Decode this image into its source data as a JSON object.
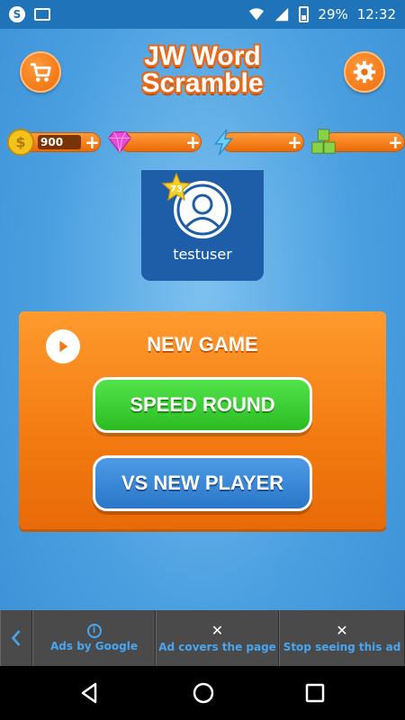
{
  "status_bar": {
    "battery": "29%",
    "time": "12:32",
    "icons": [
      "skype-icon",
      "image-icon",
      "wifi-icon",
      "signal-icon",
      "battery-icon"
    ]
  },
  "header": {
    "title_line1": "JW Word",
    "title_line2": "Scramble",
    "cart_icon": "shopping-cart-icon",
    "settings_icon": "gear-icon"
  },
  "currency": {
    "coins": "900",
    "plus": "+",
    "icons": [
      "coin-icon",
      "gem-icon",
      "lightning-icon",
      "letter-blocks-icon"
    ]
  },
  "profile": {
    "level": "73",
    "username": "testuser"
  },
  "game_panel": {
    "title": "NEW GAME",
    "speed_round": "SPEED ROUND",
    "vs_new_player": "VS NEW PLAYER"
  },
  "ad_bar": {
    "ads_by_google": "Ads by Google",
    "ad_covers": "Ad covers the page",
    "stop_seeing": "Stop seeing this ad",
    "close_glyph": "✕",
    "info_glyph": "i"
  },
  "colors": {
    "accent_orange": "#f27a10",
    "green_button": "#2cbb22",
    "blue_button": "#2a76c9",
    "status_bar": "#1f73b8",
    "ad_text": "#48a6f0"
  }
}
